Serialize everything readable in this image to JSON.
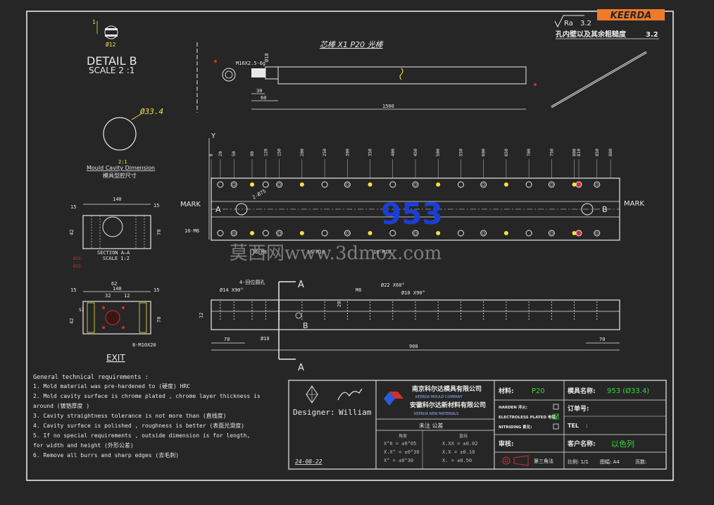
{
  "roughness": {
    "symbol": "Ra",
    "value": "3.2",
    "note": "孔内壁以及其余粗糙度",
    "note_value": "3.2"
  },
  "logo": {
    "text": "KEERDA"
  },
  "detail_b": {
    "title": "DETAIL B",
    "scale": "SCALE 2 :1",
    "dim": "Ø12",
    "dim_top": "1"
  },
  "cavity": {
    "dia": "Ø33.4",
    "caption": "Mould Cavity Dimension",
    "caption_cn": "模具型腔尺寸",
    "scale": "2:1"
  },
  "top_view": {
    "title": "芯棒 X1   P20  光棒",
    "thread": "M16X2.5-6g",
    "len_total": "1500",
    "d30": "30",
    "d60": "60",
    "d18": "Ø18"
  },
  "main": {
    "axis": "Y",
    "ticks": [
      "0",
      "20",
      "50",
      "90",
      "120",
      "150",
      "200",
      "250",
      "300",
      "350",
      "400",
      "450",
      "500",
      "550",
      "600",
      "650",
      "700",
      "750",
      "800",
      "810",
      "850",
      "880"
    ],
    "mark_left": "MARK",
    "mark_right": "MARK",
    "label_a": "A",
    "label_b": "B",
    "number": "953",
    "hole_left": "16-M6",
    "hole_left2": "2-Ø75",
    "hole_mid": "16-M8",
    "hole_mid2": "16-M10",
    "hole_r": "16-M10",
    "watermark": "莫西网www.3dmox.com"
  },
  "side_view": {
    "note": "4-回位圆孔",
    "d14": "Ø14 X90°",
    "m6": "M6",
    "d22": "Ø22 X60°",
    "d10x": "Ø10 X90°",
    "d20": "20",
    "d70_l": "70",
    "d10": "Ø10",
    "d900": "900",
    "d70_r": "70",
    "h12": "12",
    "sect": "A",
    "sect2": "A",
    "b": "B"
  },
  "section_a": {
    "w140": "140",
    "w15l": "15",
    "w15r": "15",
    "h70": "70",
    "h42": "42",
    "title": "SECTION A—A",
    "scale": "SCALE 1:2",
    "mat1": "Ø15",
    "mat2": "Ø15"
  },
  "exit_view": {
    "w140": "140",
    "w15l": "15",
    "w15r": "15",
    "d62": "62",
    "d12": "12",
    "d32": "32",
    "d42": "42",
    "d70": "70",
    "d53": "53",
    "label": "EXIT",
    "thread": "8-M10X20"
  },
  "requirements": {
    "title": "General technical requirements :",
    "lines": [
      "1. Mold material was pre-hardened to          (硬度)     HRC",
      "2. Mold cavity surface is chrome plated , chrome   layer thickness is",
      "around        (镀铬厚度 )",
      "3. Cavity straightness tolerance is not more than              (直线度)",
      "4. Cavity surface is polished , roughness is better          (表面光滑度)",
      "5. If no special requirements , outside dimension is         for length,",
      "          for width and height (外形公差)",
      "6. Remove all burrs and sharp edges  (去毛刺)"
    ]
  },
  "title_block": {
    "designer_label": "Designer:",
    "designer": "William",
    "date": "24-08-22",
    "company1": "南京科尔达模具有限公司",
    "company1_en": "KEERDA MOULD COMPANY",
    "company2": "安徽科尔达新材料有限公司",
    "company2_en": "KEERDA NEW MATERIALS",
    "note_label": "未注   公差",
    "tol_head1": "角度",
    "tol_head2": "直线",
    "tol_rows": [
      [
        "X°0 = ±0°05",
        "X.XX = ±0.02"
      ],
      [
        "X.X° = ±0°30",
        "X.X = ±0.10"
      ],
      [
        "X° = ±0°30",
        "X. = ±0.50"
      ]
    ],
    "material_label": "材料:",
    "material": "P20",
    "mould_label": "模具名称:",
    "mould": "953 (Ø33.4)",
    "order_label": "订单号:",
    "tel_label": "TEL",
    "tel_value": ":",
    "customer_label": "客户名称:",
    "customer": "以色列",
    "review_label": "审核:",
    "process1": "HARDEN 淬火:",
    "process2": "ELECTROLESS PLATED 电镀:",
    "process3": "NITRIDING 氮化:",
    "proj": "第三角法",
    "scale_label": "比例: 1/1",
    "paper_label": "图幅: A4",
    "pages_label": "页数:"
  }
}
